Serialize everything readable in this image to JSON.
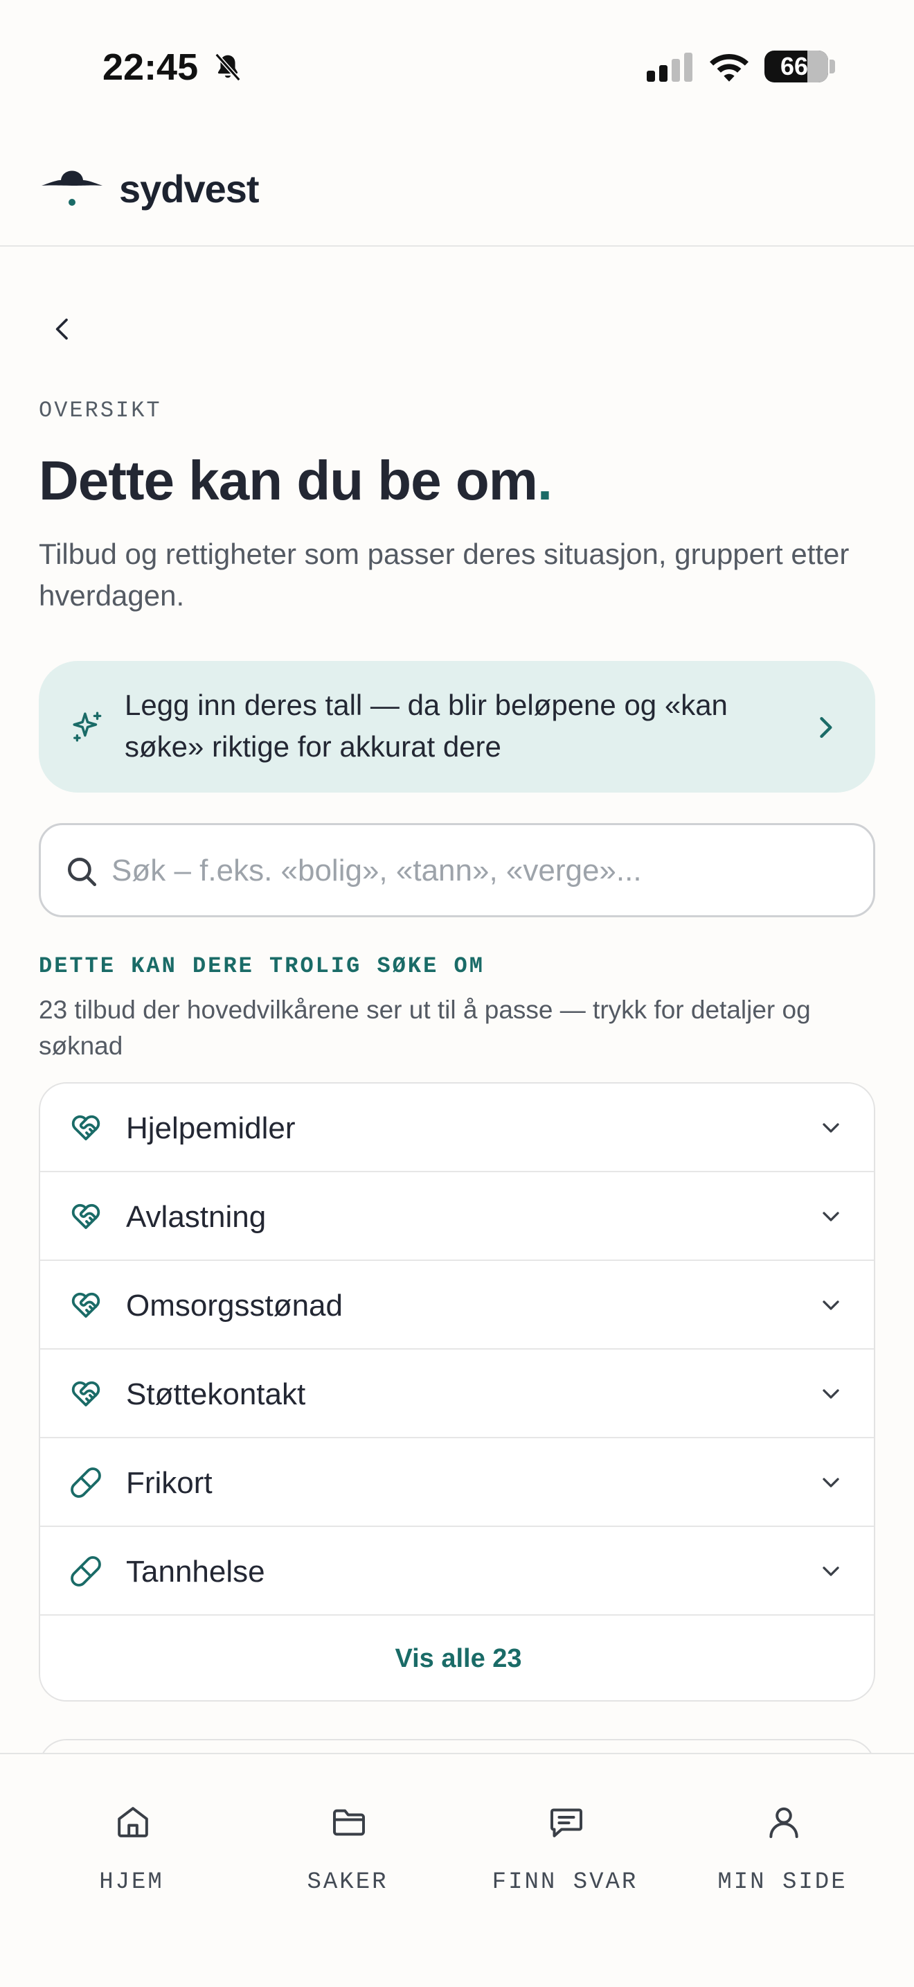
{
  "status_bar": {
    "time": "22:45",
    "battery": "66",
    "icons": [
      "bell-slash-icon",
      "signal-icon",
      "wifi-icon",
      "battery-icon"
    ]
  },
  "header": {
    "logo_text": "sydvest",
    "logo_icon": "hat-logo-icon"
  },
  "main": {
    "back_icon": "chevron-left-icon",
    "eyebrow": "OVERSIKT",
    "title": "Dette kan du be om",
    "title_dot": ".",
    "subtitle": "Tilbud og rettigheter som passer deres situasjon, gruppert etter hverdagen.",
    "banner": {
      "icon": "sparkle-icon",
      "text": "Legg inn deres tall — da blir beløpene og «kan søke» riktige for akkurat dere"
    },
    "search": {
      "placeholder": "Søk – f.eks. «bolig», «tann», «verge»...",
      "value": ""
    },
    "section": {
      "label": "DETTE KAN DERE TROLIG SØKE OM",
      "description": "23 tilbud der hovedvilkårene ser ut til å passe — trykk for detaljer og søknad",
      "items": [
        {
          "label": "Hjelpemidler",
          "icon": "heart-handshake-icon"
        },
        {
          "label": "Avlastning",
          "icon": "heart-handshake-icon"
        },
        {
          "label": "Omsorgsstønad",
          "icon": "heart-handshake-icon"
        },
        {
          "label": "Støttekontakt",
          "icon": "heart-handshake-icon"
        },
        {
          "label": "Frikort",
          "icon": "pill-icon"
        },
        {
          "label": "Tannhelse",
          "icon": "pill-icon"
        }
      ],
      "show_all": "Vis alle 23"
    }
  },
  "bottom_nav": {
    "items": [
      {
        "label": "HJEM",
        "icon": "home-icon"
      },
      {
        "label": "SAKER",
        "icon": "folder-icon"
      },
      {
        "label": "FINN SVAR",
        "icon": "message-icon"
      },
      {
        "label": "MIN SIDE",
        "icon": "user-icon"
      }
    ]
  },
  "colors": {
    "accent": "#1a6b67",
    "banner_bg": "#e2f0ee",
    "text": "#232733",
    "muted": "#545a63"
  }
}
